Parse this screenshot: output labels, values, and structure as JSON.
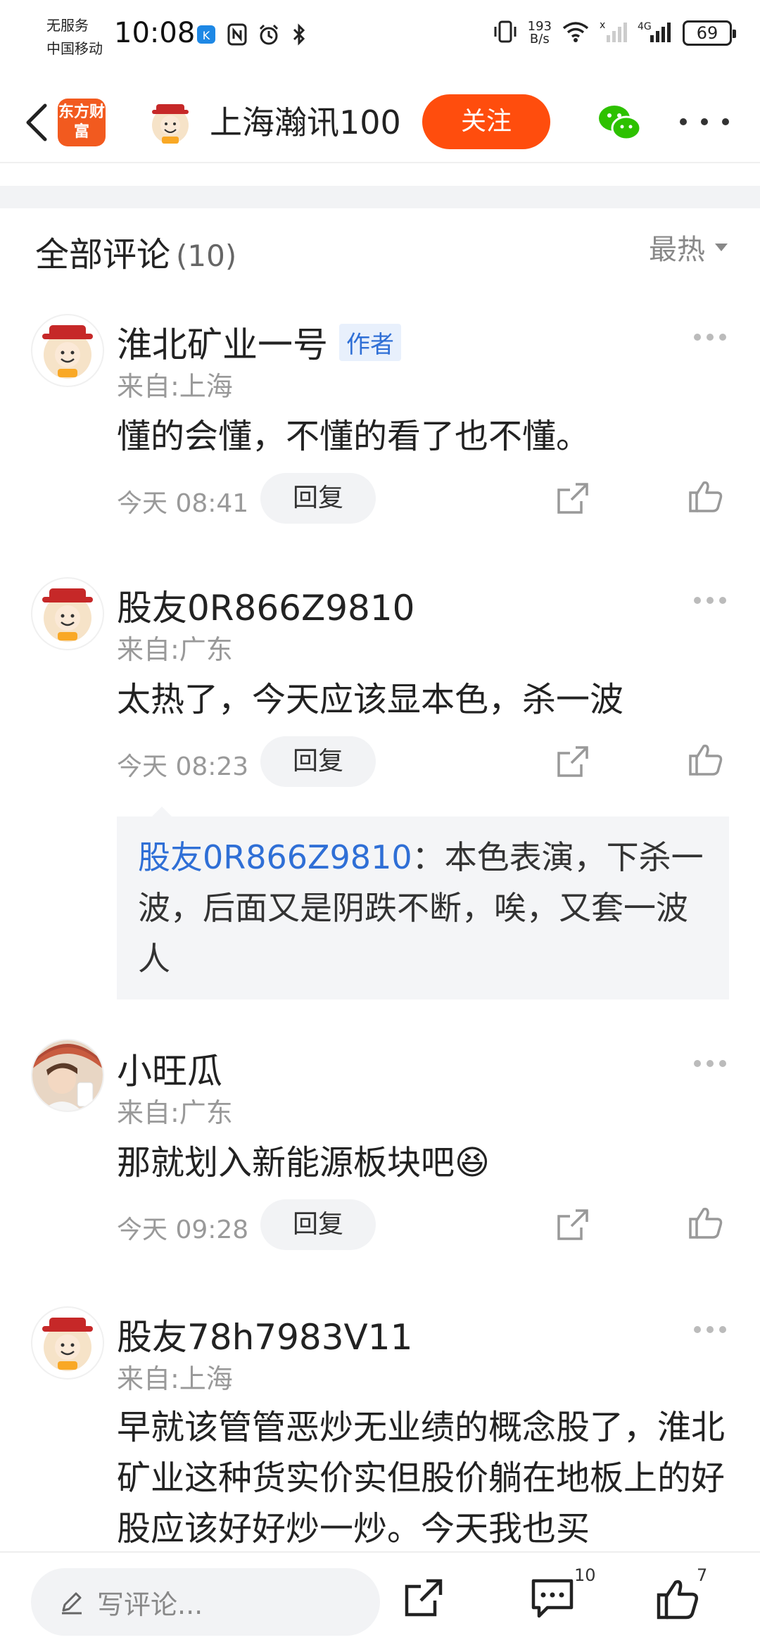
{
  "status_bar": {
    "carrier_line1": "无服务",
    "carrier_line2": "中国移动",
    "time": "10:08",
    "net_speed_value": "193",
    "net_speed_unit": "B/s",
    "network": "4G",
    "battery": "69"
  },
  "header": {
    "app_logo_text": "东方财富",
    "title": "上海瀚讯100",
    "follow_label": "关注",
    "icons": [
      "back-arrow",
      "wechat",
      "more-dots"
    ]
  },
  "comments_section": {
    "title": "全部评论",
    "count": "(10)",
    "sort_label": "最热"
  },
  "comments": [
    {
      "name": "淮北矿业一号",
      "badge": "作者",
      "location": "来自:上海",
      "text": "懂的会懂，不懂的看了也不懂。",
      "time": "今天 08:41",
      "reply_label": "回复"
    },
    {
      "name": "股友0R866Z9810",
      "location": "来自:广东",
      "text": "太热了，今天应该显本色，杀一波",
      "time": "今天 08:23",
      "reply_label": "回复",
      "sub_reply": {
        "user": "股友0R866Z9810",
        "text": "：本色表演，下杀一波，后面又是阴跌不断，唉，又套一波人"
      }
    },
    {
      "name": "小旺瓜",
      "location": "来自:广东",
      "text": "那就划入新能源板块吧😆",
      "time": "今天 09:28",
      "reply_label": "回复"
    },
    {
      "name": "股友78h7983V11",
      "location": "来自:上海",
      "text": "早就该管管恶炒无业绩的概念股了，淮北矿业这种货实价实但股价躺在地板上的好股应该好好炒一炒。今天我也买"
    }
  ],
  "bottom_bar": {
    "input_placeholder": "写评论...",
    "comment_count": "10",
    "like_count": "7"
  },
  "colors": {
    "accent": "#ff4d0d",
    "link_blue": "#2f6fd6",
    "wechat_green": "#2dc100"
  }
}
